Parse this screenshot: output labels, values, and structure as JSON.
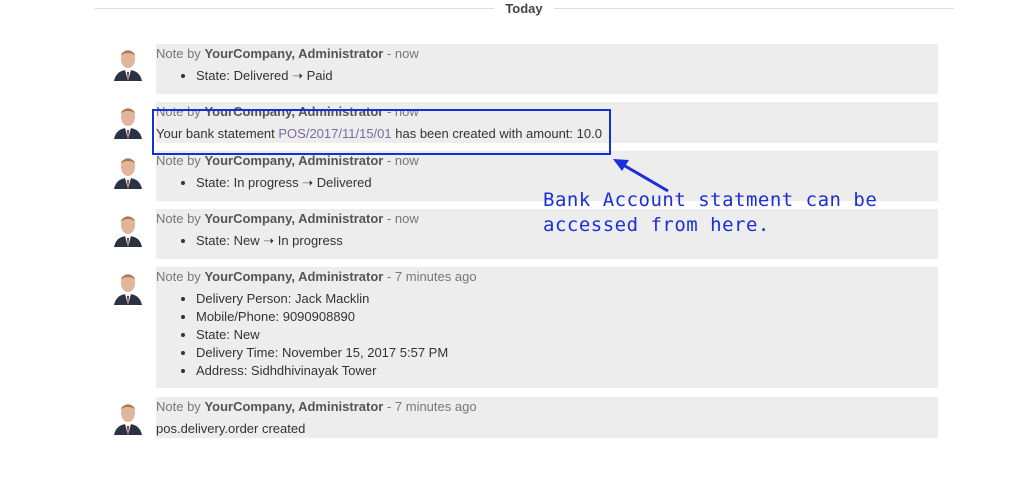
{
  "separator": {
    "label": "Today"
  },
  "messages": [
    {
      "prefix": "Note by",
      "author": "YourCompany, Administrator",
      "time": "- now",
      "bullets": [
        "State: Delivered ➝ Paid"
      ]
    },
    {
      "prefix": "Note by",
      "author": "YourCompany, Administrator",
      "time": "- now",
      "text_before": "Your bank statement ",
      "link": "POS/2017/11/15/01",
      "text_after": " has been created with amount: 10.0"
    },
    {
      "prefix": "Note by",
      "author": "YourCompany, Administrator",
      "time": "- now",
      "bullets": [
        "State: In progress ➝ Delivered"
      ]
    },
    {
      "prefix": "Note by",
      "author": "YourCompany, Administrator",
      "time": "- now",
      "bullets": [
        "State: New ➝ In progress"
      ]
    },
    {
      "prefix": "Note by",
      "author": "YourCompany, Administrator",
      "time": "- 7 minutes ago",
      "bullets": [
        "Delivery Person: Jack Macklin",
        "Mobile/Phone: 9090908890",
        "State: New",
        "Delivery Time: November 15, 2017 5:57 PM",
        "Address: Sidhdhivinayak Tower"
      ]
    },
    {
      "prefix": "Note by",
      "author": "YourCompany, Administrator",
      "time": "- 7 minutes ago",
      "text": "pos.delivery.order created"
    }
  ],
  "annotation": {
    "line1": "Bank Account statment can be",
    "line2": "accessed from here.",
    "color": "#1a2fd6"
  },
  "avatar_icon": "user-avatar-icon"
}
